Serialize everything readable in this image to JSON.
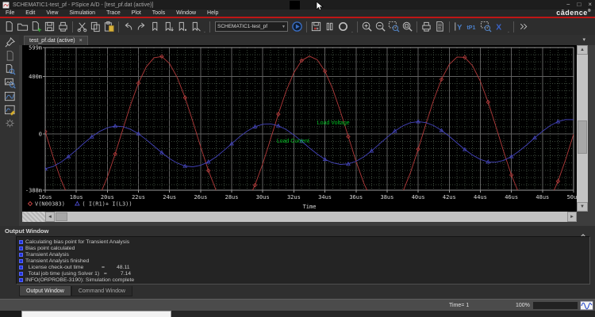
{
  "window": {
    "title": "SCHEMATIC1-test_pf - PSpice A/D  - [test_pf.dat (active)]",
    "brand": "cādence",
    "brand_reg": "®",
    "controls": {
      "minimize": "−",
      "maximize": "□",
      "close": "×"
    }
  },
  "menu": {
    "items": [
      "File",
      "Edit",
      "View",
      "Simulation",
      "Trace",
      "Plot",
      "Tools",
      "Window",
      "Help"
    ]
  },
  "toolbar": {
    "profile_value": "SCHEMATIC1-test_pf",
    "buttons": [
      {
        "name": "new-file",
        "icon": "page"
      },
      {
        "name": "open-file",
        "icon": "folder"
      },
      {
        "name": "append-waveform",
        "icon": "page-plus"
      },
      {
        "name": "save",
        "icon": "floppy"
      },
      {
        "name": "print",
        "icon": "printer"
      },
      {
        "sep": true
      },
      {
        "name": "cut",
        "icon": "scissors"
      },
      {
        "name": "copy",
        "icon": "copy"
      },
      {
        "name": "paste",
        "icon": "paste"
      },
      {
        "sep": true
      },
      {
        "name": "undo",
        "icon": "undo"
      },
      {
        "name": "redo",
        "icon": "redo"
      },
      {
        "name": "voltage-marker",
        "icon": "marker"
      },
      {
        "name": "voltage-diff-marker",
        "icon": "marker-down"
      },
      {
        "name": "current-marker",
        "icon": "marker-dot"
      },
      {
        "name": "power-marker",
        "icon": "marker-slash"
      },
      {
        "dots": true
      },
      {
        "sep": true
      },
      {
        "combo": true,
        "name": "simulation-profile-select"
      },
      {
        "name": "run-simulation",
        "icon": "run"
      },
      {
        "sep": true
      },
      {
        "name": "view-simulation-results",
        "icon": "floppy-red"
      },
      {
        "name": "pause-simulation",
        "icon": "pause"
      },
      {
        "name": "stop-simulation",
        "icon": "stop"
      },
      {
        "dots": true
      },
      {
        "sep": true
      },
      {
        "name": "zoom-in",
        "icon": "zoom-in"
      },
      {
        "name": "zoom-out",
        "icon": "zoom-out"
      },
      {
        "name": "zoom-area",
        "icon": "zoom-area"
      },
      {
        "name": "zoom-fit",
        "icon": "zoom-fit"
      },
      {
        "sep": true
      },
      {
        "name": "print-plot",
        "icon": "printer"
      },
      {
        "name": "page-setup",
        "icon": "page-lines"
      },
      {
        "sep": true
      },
      {
        "name": "toggle-cursor",
        "icon": "cursor-y"
      },
      {
        "name": "evaluate-measurement",
        "icon": "measure"
      },
      {
        "name": "mark-data-points",
        "icon": "zoom-area"
      },
      {
        "name": "delete-all-traces",
        "icon": "delete-x"
      },
      {
        "dots": true
      },
      {
        "sep": true
      },
      {
        "name": "toolbar-overflow",
        "icon": "chevrons"
      }
    ]
  },
  "sidebar": {
    "items": [
      {
        "name": "pin-panel",
        "icon": "pin"
      },
      {
        "name": "new-simulation",
        "icon": "page",
        "dim": true
      },
      {
        "name": "view-output-file",
        "icon": "page-mag"
      },
      {
        "name": "view-schematic",
        "icon": "img-mag"
      },
      {
        "name": "view-simulation-results",
        "icon": "chart"
      },
      {
        "name": "edit-simulation-profile",
        "icon": "chart-edit"
      },
      {
        "name": "simulation-settings",
        "icon": "gear",
        "dim": true
      }
    ]
  },
  "tabbar": {
    "tabs": [
      {
        "label": "test_pf.dat (active)",
        "close": "×"
      }
    ],
    "overflow": "▾"
  },
  "chart_data": {
    "type": "line",
    "xlabel": "Time",
    "x_unit": "us",
    "x_range": [
      16,
      50
    ],
    "x_step": 0.5,
    "y_unit": "m",
    "y_range": [
      -388,
      599
    ],
    "x_tick_labels": [
      "16us",
      "18us",
      "20us",
      "22us",
      "24us",
      "26us",
      "28us",
      "30us",
      "32us",
      "34us",
      "36us",
      "38us",
      "40us",
      "42us",
      "44us",
      "46us",
      "48us",
      "50us"
    ],
    "y_ticks": [
      {
        "v": 599,
        "label": "599m"
      },
      {
        "v": 400,
        "label": "400m"
      },
      {
        "v": 0,
        "label": "0"
      },
      {
        "v": -388,
        "label": "-388m"
      }
    ],
    "grid": {
      "minor_color": "#3a473a",
      "major_color": "#5f5f5f",
      "frame_color": "#9a9a9a"
    },
    "series": [
      {
        "name": "V(N00383)",
        "color": "#b23b3b",
        "marker": "diamond",
        "values": [
          18,
          -155,
          -312,
          -436,
          -515,
          -540,
          -509,
          -425,
          -297,
          -138,
          35,
          205,
          353,
          465,
          528,
          537,
          489,
          391,
          252,
          87,
          -87,
          -252,
          -391,
          -489,
          -536,
          -528,
          -465,
          -353,
          -205,
          -35,
          138,
          297,
          425,
          509,
          540,
          515,
          436,
          312,
          155,
          -17,
          -188,
          -340,
          -455,
          -524,
          -538,
          -496,
          -402,
          -268,
          -104,
          70,
          237,
          379,
          482,
          534,
          531,
          473,
          366,
          221,
          53,
          -121,
          -283,
          -414,
          -503,
          -539,
          -520,
          -446,
          -326,
          -172,
          0
        ]
      },
      {
        "name": "( I(R1)+ I(L3))",
        "color": "#4444bb",
        "marker": "triangle",
        "values": [
          -240,
          -224,
          -195,
          -155,
          -110,
          -62,
          -18,
          19,
          44,
          56,
          52,
          33,
          3,
          -38,
          -83,
          -128,
          -169,
          -201,
          -221,
          -226,
          -216,
          -192,
          -157,
          -113,
          -66,
          -19,
          21,
          51,
          68,
          71,
          58,
          32,
          -5,
          -49,
          -95,
          -138,
          -174,
          -199,
          -210,
          -206,
          -188,
          -157,
          -116,
          -69,
          -22,
          21,
          56,
          79,
          87,
          80,
          59,
          26,
          -15,
          -61,
          -106,
          -145,
          -175,
          -192,
          -194,
          -182,
          -155,
          -117,
          -73,
          -25,
          20,
          59,
          87,
          101,
          100
        ]
      }
    ],
    "annotations": [
      {
        "text": "Load Voltage",
        "t": 33.5,
        "v": 68,
        "color": "#00bb22"
      },
      {
        "text": "Load Current",
        "t": 30.9,
        "v": -59,
        "color": "#00bb22"
      }
    ],
    "legend_position": "bottom-left"
  },
  "output_window": {
    "title": "Output Window",
    "rows": [
      "Calculating bias point for Transient Analysis",
      "Bias point calculated",
      "Transient Analysis",
      "Transient Analysis finished",
      "  License check-out time            =        48.11",
      "  Total job time (using Solver 1)   =         7.14",
      "INFO(ORPROBE-3190): Simulation complete"
    ],
    "tabs": [
      "Output Window",
      "Command Window"
    ]
  },
  "statusbar": {
    "time_label": "Time= 1",
    "progress_label": "100%",
    "progress_pct": 100
  }
}
